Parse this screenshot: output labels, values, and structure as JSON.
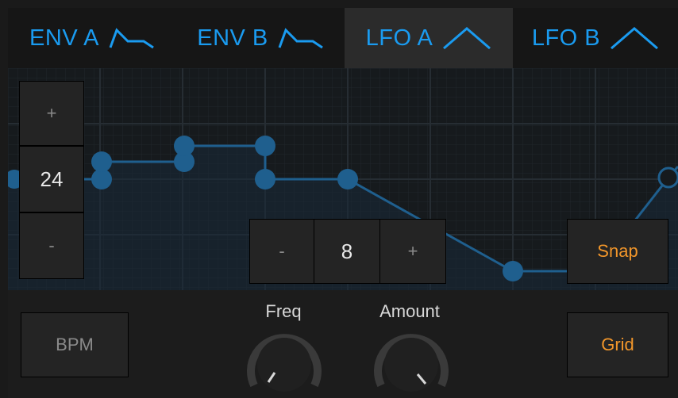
{
  "tabs": [
    {
      "label": "ENV A",
      "icon": "envelope-icon",
      "active": false
    },
    {
      "label": "ENV B",
      "icon": "envelope-icon",
      "active": false
    },
    {
      "label": "LFO A",
      "icon": "triangle-wave-icon",
      "active": true
    },
    {
      "label": "LFO B",
      "icon": "triangle-wave-icon",
      "active": false
    }
  ],
  "colors": {
    "accent_blue": "#1a9bf0",
    "node_blue": "#1f5f8e",
    "orange": "#f2962a"
  },
  "left_stepper": {
    "plus": "+",
    "value": "24",
    "minus": "-"
  },
  "center_stepper": {
    "minus": "-",
    "value": "8",
    "plus": "+"
  },
  "buttons": {
    "snap": "Snap",
    "bpm": "BPM",
    "grid": "Grid"
  },
  "knobs": {
    "freq_label": "Freq",
    "amount_label": "Amount"
  }
}
